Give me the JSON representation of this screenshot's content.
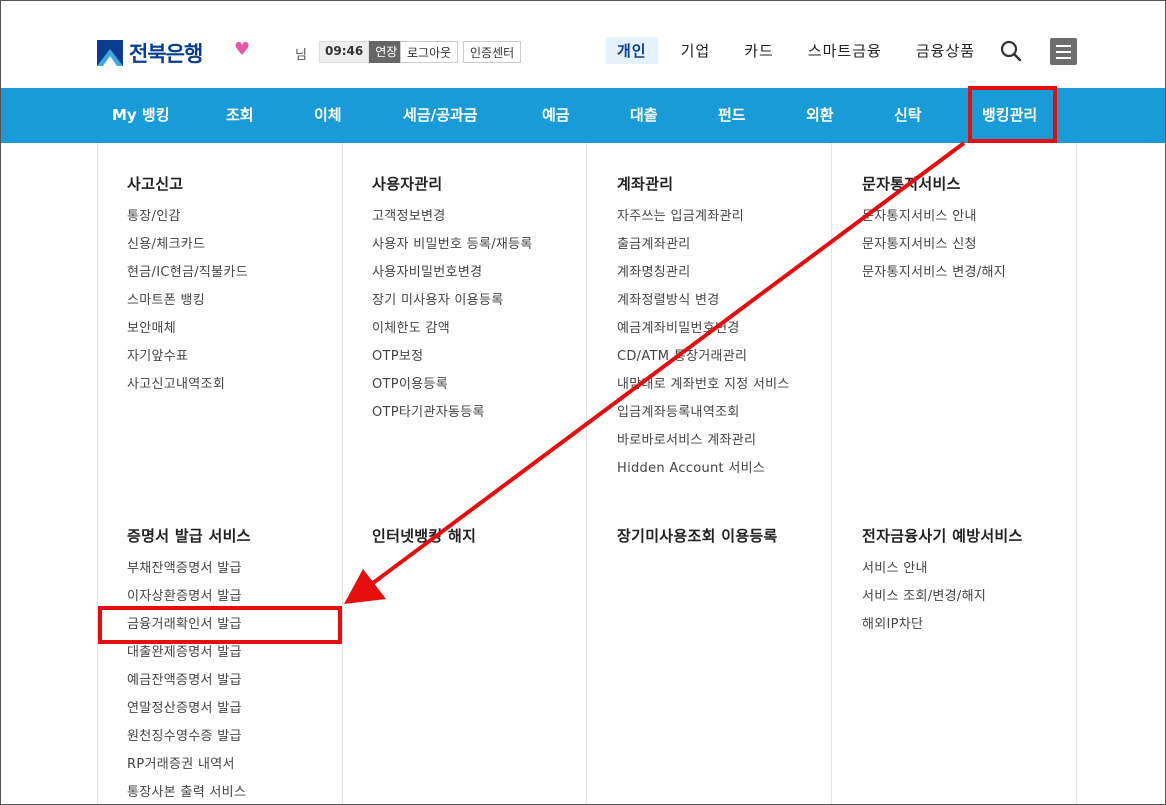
{
  "header": {
    "logo_text": "전북은행",
    "heart_icon": "heart-icon",
    "user_suffix": "님",
    "session_time": "09:46",
    "extend_label": "연장",
    "logout_label": "로그아웃",
    "cert_center_label": "인증센터",
    "top_nav": [
      "개인",
      "기업",
      "카드",
      "스마트금융",
      "금융상품"
    ],
    "search_icon": "search-icon",
    "menu_icon": "hamburger-menu-icon",
    "brand_color": "#0a3d8f",
    "active_tab_bg": "#e6f2fb"
  },
  "gnb": {
    "bg_color": "#199bd8",
    "items": [
      "My 뱅킹",
      "조회",
      "이체",
      "세금/공과금",
      "예금",
      "대출",
      "펀드",
      "외환",
      "신탁",
      "뱅킹관리"
    ],
    "highlighted_item": "뱅킹관리"
  },
  "mega_menu": {
    "groups": [
      {
        "title": "사고신고",
        "items": [
          "통장/인감",
          "신용/체크카드",
          "현금/IC현금/직불카드",
          "스마트폰 뱅킹",
          "보안매체",
          "자기앞수표",
          "사고신고내역조회"
        ]
      },
      {
        "title": "사용자관리",
        "items": [
          "고객정보변경",
          "사용자 비밀번호 등록/재등록",
          "사용자비밀번호변경",
          "장기 미사용자 이용등록",
          "이체한도 감액",
          "OTP보정",
          "OTP이용등록",
          "OTP타기관자동등록"
        ]
      },
      {
        "title": "계좌관리",
        "items": [
          "자주쓰는 입금계좌관리",
          "출금계좌관리",
          "계좌명칭관리",
          "계좌정렬방식 변경",
          "예금계좌비밀번호변경",
          "CD/ATM 통장거래관리",
          "내맘대로 계좌번호 지정 서비스",
          "입금계좌등록내역조회",
          "바로바로서비스 계좌관리",
          "Hidden Account 서비스"
        ]
      },
      {
        "title": "문자통지서비스",
        "items": [
          "문자통지서비스 안내",
          "문자통지서비스 신청",
          "문자통지서비스 변경/해지"
        ]
      },
      {
        "title": "증명서 발급 서비스",
        "items": [
          "부채잔액증명서 발급",
          "이자상환증명서 발급",
          "금융거래확인서 발급",
          "대출완제증명서 발급",
          "예금잔액증명서 발급",
          "연말정산증명서 발급",
          "원천징수영수증 발급",
          "RP거래증권 내역서",
          "통장사본 출력 서비스"
        ]
      },
      {
        "title": "인터넷뱅킹 해지",
        "items": []
      },
      {
        "title": "장기미사용조회 이용등록",
        "items": []
      },
      {
        "title": "전자금융사기 예방서비스",
        "items": [
          "서비스 안내",
          "서비스 조회/변경/해지",
          "해외IP차단"
        ]
      }
    ],
    "highlighted_item": "금융거래확인서 발급"
  },
  "annotation": {
    "color": "#e60d0d"
  }
}
